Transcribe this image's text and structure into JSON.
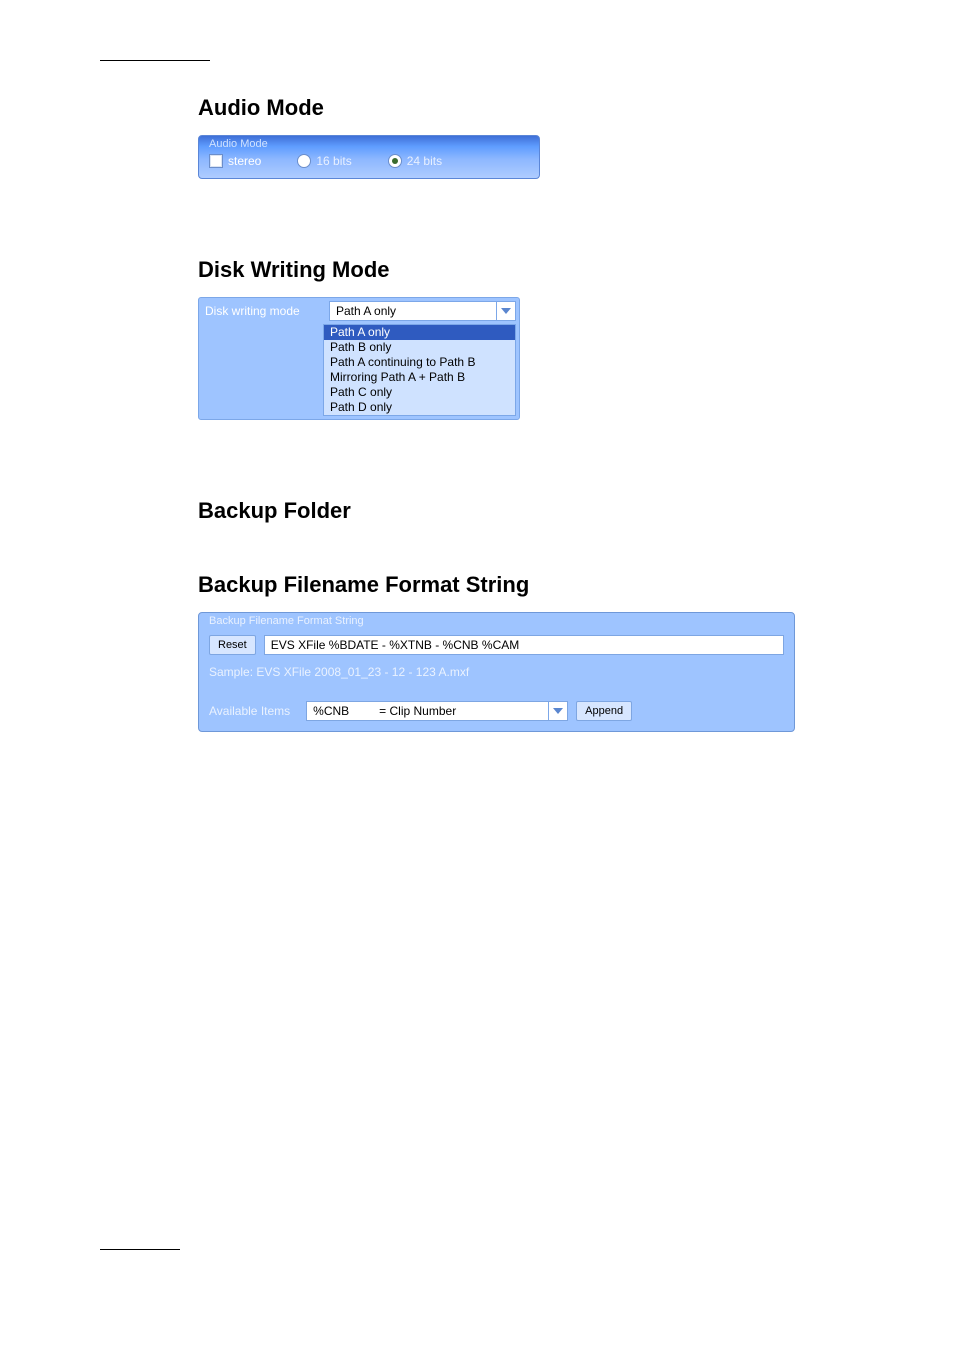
{
  "headings": {
    "audio_mode": "Audio  Mode",
    "disk_writing_mode": "Disk  Writing  Mode",
    "backup_folder": "Backup  Folder",
    "backup_filename_format": "Backup  Filename  Format  String"
  },
  "audio_mode": {
    "legend": "Audio Mode",
    "stereo_label": "stereo",
    "stereo_checked": false,
    "bits16_label": "16 bits",
    "bits16_selected": false,
    "bits24_label": "24 bits",
    "bits24_selected": true
  },
  "disk_writing_mode": {
    "label": "Disk writing mode",
    "selected_value": "Path A only",
    "selected_index": 0,
    "options": [
      "Path A only",
      "Path B only",
      "Path A continuing to Path B",
      "Mirroring Path A + Path B",
      "Path C only",
      "Path D only"
    ]
  },
  "backup_filename": {
    "legend": "Backup Filename Format String",
    "reset_label": "Reset",
    "format_value": "EVS XFile %BDATE - %XTNB - %CNB %CAM",
    "sample_prefix": "Sample: ",
    "sample_value": "EVS XFile 2008_01_23 - 12 - 123 A.mxf",
    "available_items_label": "Available Items",
    "available_item_code": "%CNB",
    "available_item_desc": "= Clip Number",
    "append_label": "Append"
  }
}
